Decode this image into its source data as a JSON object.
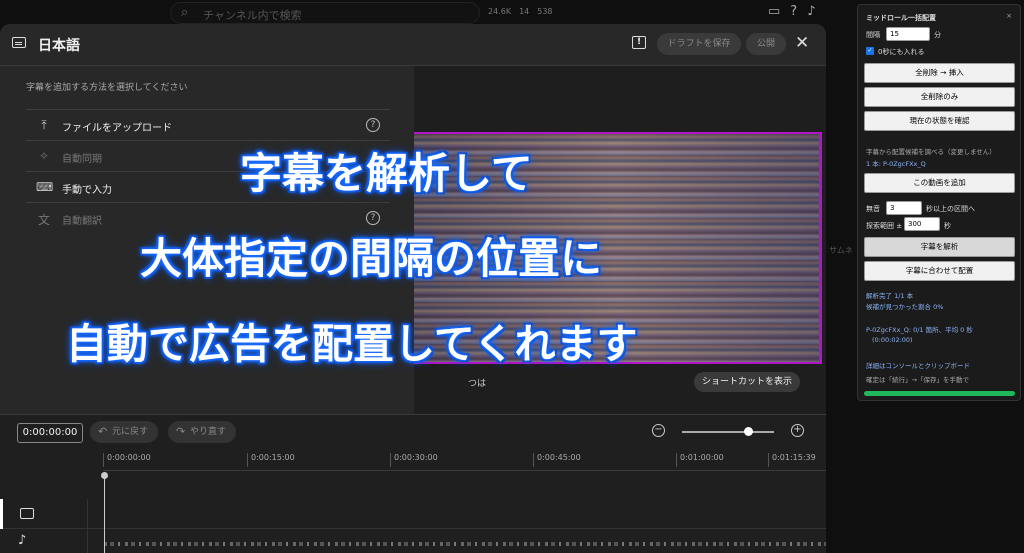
{
  "topbar": {
    "search_placeholder": "チャンネル内で検索",
    "stat1": "24.6K",
    "stat2": "14",
    "stat3": "538"
  },
  "dialog": {
    "title": "日本語",
    "save_draft": "ドラフトを保存",
    "publish": "公開",
    "select_label": "字幕を追加する方法を選択してください",
    "options": [
      {
        "label": "ファイルをアップロード",
        "icon": "upload-icon"
      },
      {
        "label": "自動同期",
        "icon": "sparkle-icon"
      },
      {
        "label": "手動で入力",
        "icon": "keyboard-icon"
      },
      {
        "label": "自動翻訳",
        "icon": "translate-icon"
      }
    ],
    "shortcut_button": "ショートカットを表示",
    "video_tag": "つは"
  },
  "timeline": {
    "timecode": "0:00:00:00",
    "undo": "元に戻す",
    "redo": "やり直す",
    "ticks": [
      "0:00:00:00",
      "0:00:15:00",
      "0:00:30:00",
      "0:00:45:00",
      "0:01:00:00",
      "0:01:15:39"
    ],
    "zoom_level": 0.72
  },
  "overlay": {
    "line1": "字幕を解析して",
    "line2": "大体指定の間隔の位置に",
    "line3": "自動で広告を配置してくれます"
  },
  "panel": {
    "title": "ミッドロール一括配置",
    "close": "×",
    "interval_label": "間隔",
    "interval_value": "15",
    "interval_unit": "分",
    "zero_sec_label": "0秒にも入れる",
    "btn_delete_insert": "全削除 → 挿入",
    "btn_delete_only": "全削除のみ",
    "btn_check_state": "現在の状態を確認",
    "subtitle_note": "字幕から配置候補を調べる（変更しません）",
    "video_count": "1 本: P-0ZgcFXx_Q",
    "btn_add_video": "この動画を追加",
    "silence_label": "無音",
    "silence_value": "3",
    "silence_suffix": "秒以上の区間へ",
    "range_label": "探索範囲 ±",
    "range_value": "300",
    "range_unit": "秒",
    "btn_analyze": "字幕を解析",
    "btn_place": "字幕に合わせて配置",
    "result1": "解析完了 1/1 本",
    "result2": "候補が見つかった割合 0%",
    "result3": "P-0ZgcFXx_Q: 0/1 箇所、平均 0 秒",
    "result4": "(0:00:02:00)",
    "detail": "詳細はコンソールとクリップボード",
    "confirm_note": "確定は「続行」→「保存」を手動で",
    "progress": 1.0
  },
  "side_text": "サムネ"
}
